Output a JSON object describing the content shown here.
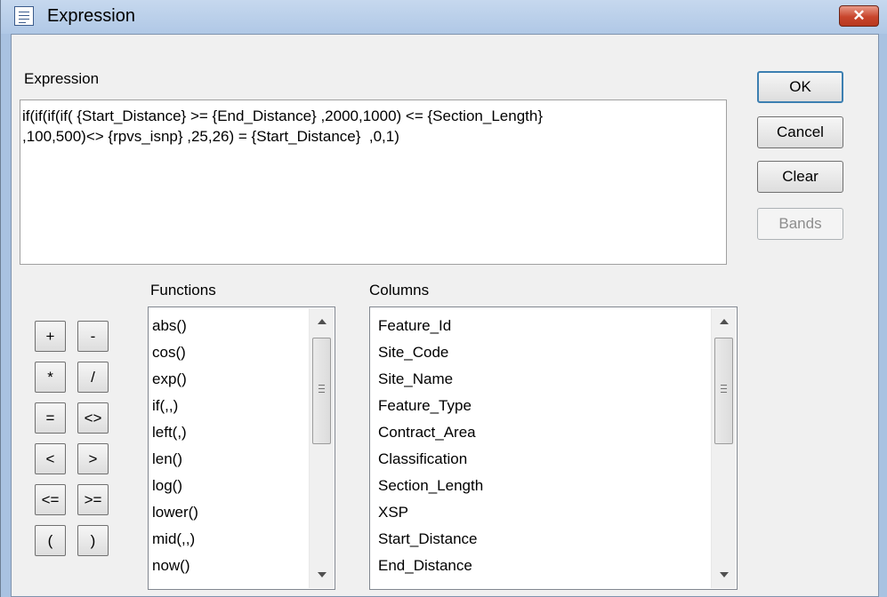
{
  "window": {
    "title": "Expression",
    "close_glyph": "✕"
  },
  "expression": {
    "label": "Expression",
    "value": "if(if(if(if( {Start_Distance} >= {End_Distance} ,2000,1000) <= {Section_Length}\n,100,500)<> {rpvs_isnp} ,25,26) = {Start_Distance}  ,0,1)"
  },
  "buttons": {
    "ok": "OK",
    "cancel": "Cancel",
    "clear": "Clear",
    "bands": "Bands",
    "bands_enabled": false
  },
  "operators": [
    "+",
    "-",
    "*",
    "/",
    "=",
    "<>",
    "<",
    ">",
    "<=",
    ">=",
    "(",
    ")"
  ],
  "functions": {
    "label": "Functions",
    "items": [
      "abs()",
      "cos()",
      "exp()",
      "if(,,)",
      "left(,)",
      "len()",
      "log()",
      "lower()",
      "mid(,,)",
      "now()"
    ]
  },
  "columns": {
    "label": "Columns",
    "items": [
      "Feature_Id",
      "Site_Code",
      "Site_Name",
      "Feature_Type",
      "Contract_Area",
      "Classification",
      "Section_Length",
      "XSP",
      "Start_Distance",
      "End_Distance"
    ]
  },
  "colors": {
    "titlebar": "#b9cfea",
    "dialog_bg": "#f0f0f0",
    "close_button": "#c8452c",
    "ok_border": "#3c7fb1"
  }
}
